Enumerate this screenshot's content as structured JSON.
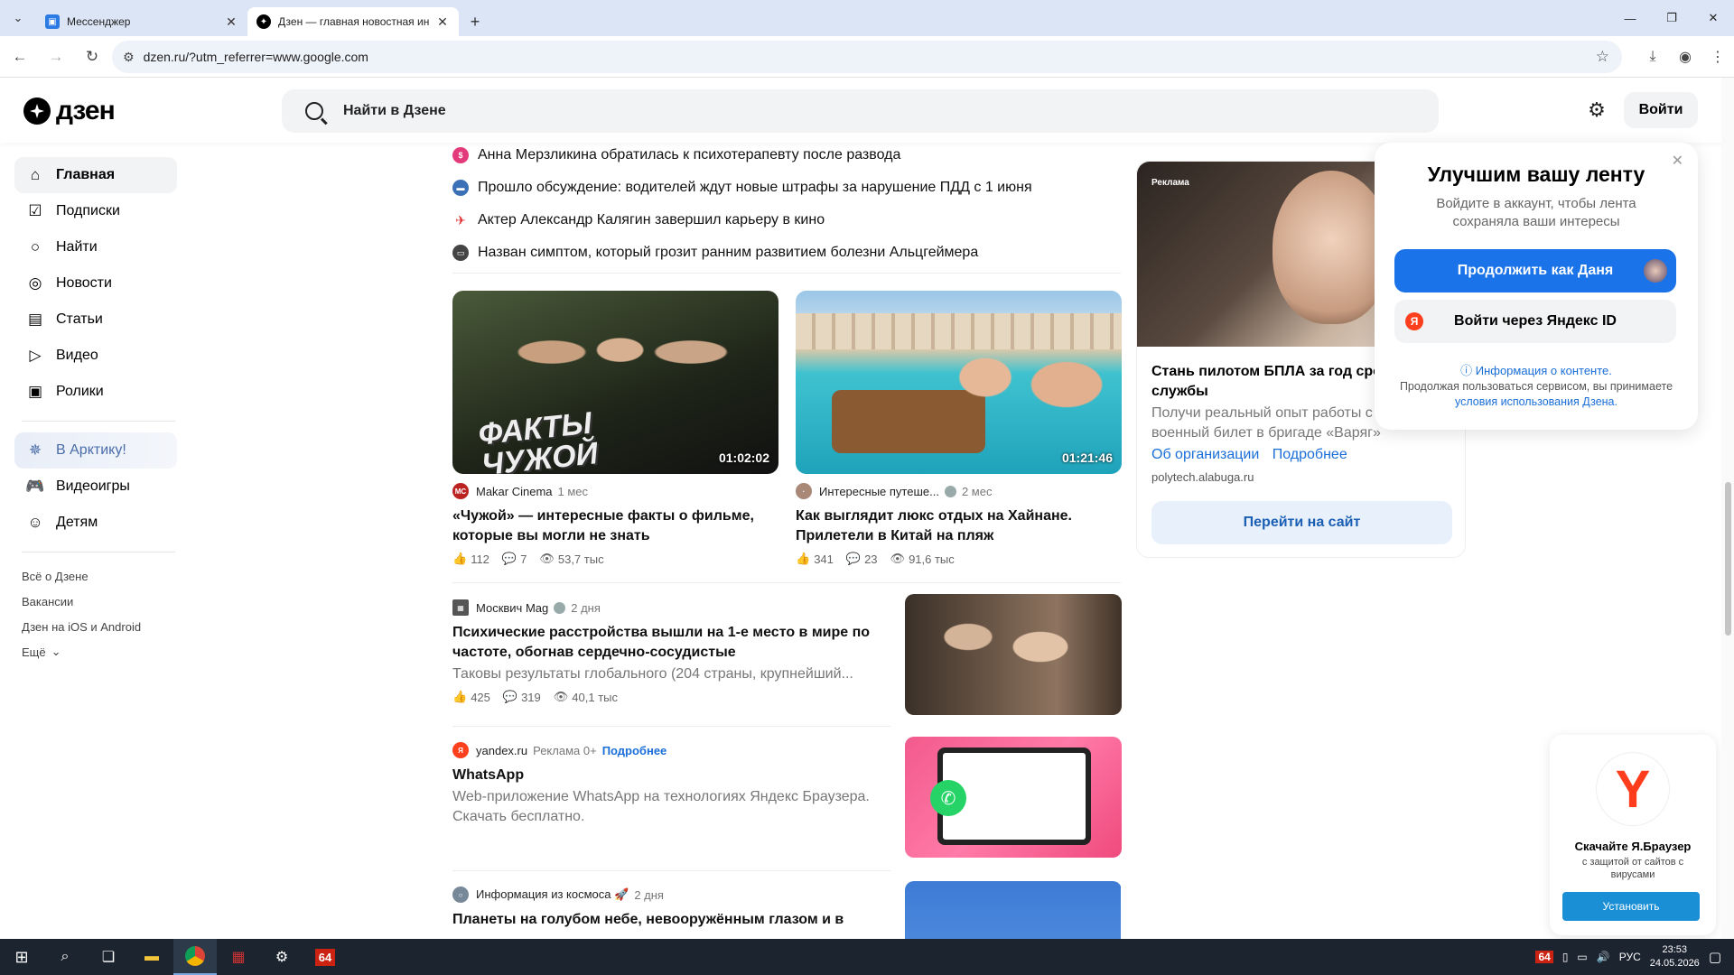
{
  "browser": {
    "tabs": [
      {
        "title": "Мессенджер",
        "active": false
      },
      {
        "title": "Дзен — главная новостная ин",
        "active": true
      }
    ],
    "url": "dzen.ru/?utm_referrer=www.google.com"
  },
  "header": {
    "logo": "дзен",
    "search_placeholder": "Найти в Дзене",
    "login": "Войти"
  },
  "sidebar": {
    "items": [
      {
        "label": "Главная",
        "icon": "home-icon"
      },
      {
        "label": "Подписки",
        "icon": "subscriptions-icon"
      },
      {
        "label": "Найти",
        "icon": "search-icon"
      },
      {
        "label": "Новости",
        "icon": "news-icon"
      },
      {
        "label": "Статьи",
        "icon": "articles-icon"
      },
      {
        "label": "Видео",
        "icon": "video-icon"
      },
      {
        "label": "Ролики",
        "icon": "clips-icon"
      }
    ],
    "arctic": "В Арктику!",
    "extra": [
      {
        "label": "Видеоигры",
        "icon": "gamepad-icon"
      },
      {
        "label": "Детям",
        "icon": "kids-icon"
      }
    ],
    "links": [
      "Всё о Дзене",
      "Вакансии",
      "Дзен на iOS и Android",
      "Ещё"
    ]
  },
  "news": [
    "Анна Мерзликина обратилась к психотерапевту после развода",
    "Прошло обсуждение: водителей ждут новые штрафы за нарушение ПДД с 1 июня",
    "Актер Александр Калягин завершил карьеру в кино",
    "Назван симптом, который грозит ранним развитием болезни Альцгеймера"
  ],
  "videos": [
    {
      "duration": "01:02:02",
      "thumb_text": "ФАКТЫ ЧУЖОЙ",
      "channel": "Makar Cinema",
      "ago": "1 мес",
      "title": "«Чужой» — интересные факты о фильме, которые вы могли не знать",
      "likes": "112",
      "comments": "7",
      "views": "53,7 тыс"
    },
    {
      "duration": "01:21:46",
      "channel": "Интересные путеше...",
      "ago": "2 мес",
      "title": "Как выглядит люкс отдых на Хайнане. Прилетели в Китай на пляж",
      "likes": "341",
      "comments": "23",
      "views": "91,6 тыс"
    }
  ],
  "articles": [
    {
      "channel": "Москвич Mag",
      "ago": "2 дня",
      "title": "Психические расстройства вышли на 1-е место в мире по частоте, обогнав сердечно-сосудистые",
      "desc": "Таковы результаты глобального (204 страны, крупнейший...",
      "likes": "425",
      "comments": "319",
      "views": "40,1 тыс"
    },
    {
      "channel": "yandex.ru",
      "ad": "Реклама 0+",
      "more": "Подробнее",
      "title": "WhatsApp",
      "desc": "Web-приложение WhatsApp на технологиях Яндекс Браузера. Скачать бесплатно."
    },
    {
      "channel": "Информация из космоса 🚀",
      "ago": "2 дня",
      "title": "Планеты на голубом небе, невооружённым глазом и в"
    }
  ],
  "ad_card": {
    "tag": "Реклама",
    "title": "Стань пилотом БПЛА за год сроч службы",
    "desc": "Получи реальный опыт работы с д и военный билет в бригаде «Варяг»",
    "link1": "Об организации",
    "link2": "Подробнее",
    "domain": "polytech.alabuga.ru",
    "button": "Перейти на сайт"
  },
  "popup": {
    "title": "Улучшим вашу ленту",
    "subtitle": "Войдите в аккаунт, чтобы лента сохраняла ваши интересы",
    "continue": "Продолжить как Даня",
    "yandex_id": "Войти через Яндекс ID",
    "info": "ⓘ Информация о контенте.",
    "terms_pre": "Продолжая пользоваться сервисом, вы принимаете",
    "terms_link": "условия использования Дзена."
  },
  "promo": {
    "title": "Скачайте Я.Браузер",
    "subtitle": "с защитой от сайтов с вирусами",
    "button": "Установить"
  },
  "taskbar": {
    "lang": "РУС",
    "time": "23:53",
    "date": "24.05.2026",
    "badge": "64"
  }
}
